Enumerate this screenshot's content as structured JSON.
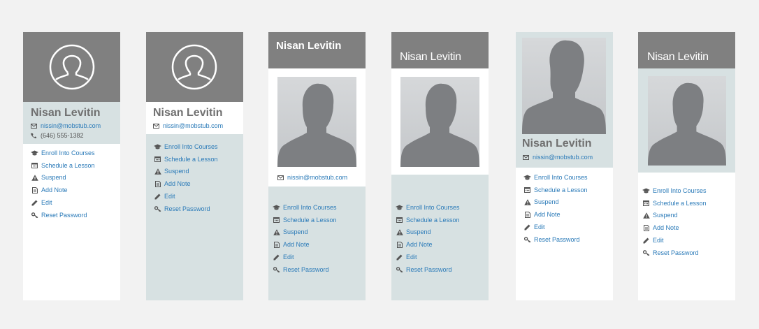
{
  "user": {
    "name": "Nisan Levitin",
    "email": "nissin@mobstub.com",
    "phone": "(646) 555-1382"
  },
  "menu": [
    {
      "label": "Enroll Into Courses",
      "icon": "graduation-cap-icon"
    },
    {
      "label": "Schedule a Lesson",
      "icon": "calendar-icon"
    },
    {
      "label": "Suspend",
      "icon": "warning-icon"
    },
    {
      "label": "Add Note",
      "icon": "note-icon"
    },
    {
      "label": "Edit",
      "icon": "pencil-icon"
    },
    {
      "label": "Reset Password",
      "icon": "key-icon"
    }
  ],
  "colors": {
    "background": "#f2f2f2",
    "header_gray": "#808080",
    "panel_blue": "#d7e1e2",
    "link": "#2a7ab8",
    "name_gray": "#707070"
  }
}
